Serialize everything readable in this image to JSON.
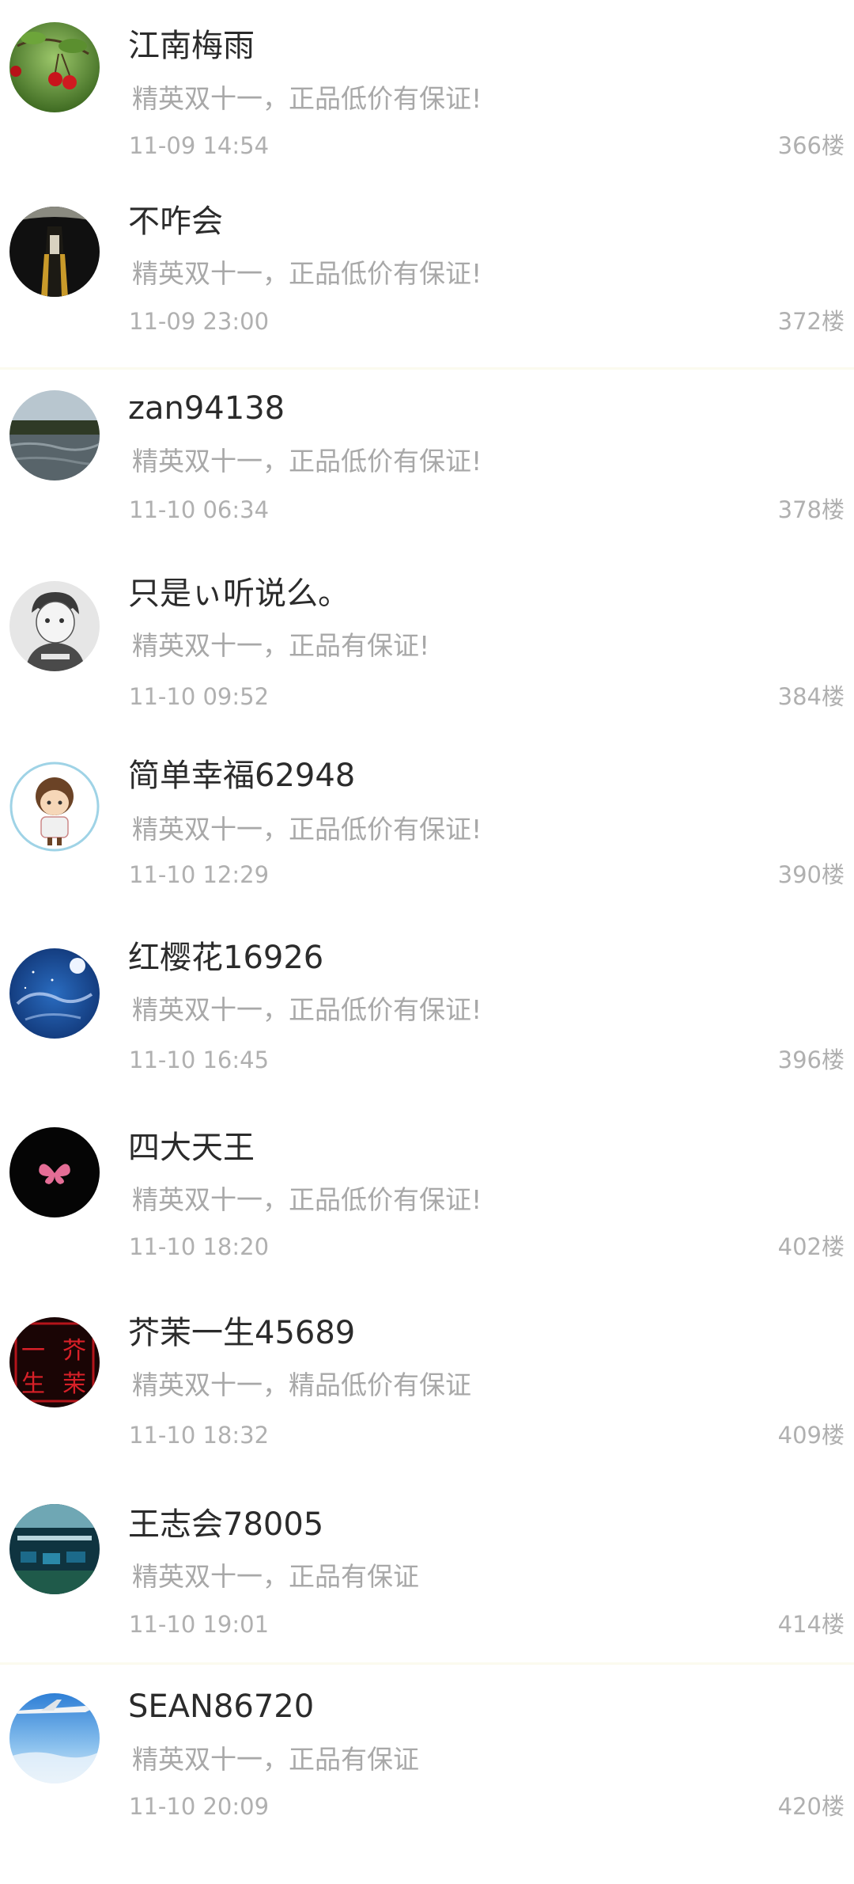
{
  "comments": [
    {
      "username": "江南梅雨",
      "message": "精英双十一，正品低价有保证!",
      "time": "11-09 14:54",
      "floor": "366楼",
      "avatar_icon": "cherry-photo-icon"
    },
    {
      "username": "不咋会",
      "message": "精英双十一，正品低价有保证!",
      "time": "11-09 23:00",
      "floor": "372楼",
      "avatar_icon": "bottle-photo-icon"
    },
    {
      "username": "zan94138",
      "message": "精英双十一，正品低价有保证!",
      "time": "11-10 06:34",
      "floor": "378楼",
      "avatar_icon": "lake-photo-icon"
    },
    {
      "username": "只是ぃ听说么。",
      "message": "精英双十一，正品有保证!",
      "time": "11-10 09:52",
      "floor": "384楼",
      "avatar_icon": "anime-boy-icon"
    },
    {
      "username": "简单幸福62948",
      "message": "精英双十一，正品低价有保证!",
      "time": "11-10 12:29",
      "floor": "390楼",
      "avatar_icon": "cartoon-girl-icon"
    },
    {
      "username": "红樱花16926",
      "message": "精英双十一，正品低价有保证!",
      "time": "11-10 16:45",
      "floor": "396楼",
      "avatar_icon": "night-sky-icon"
    },
    {
      "username": "四大天王",
      "message": "精英双十一，正品低价有保证!",
      "time": "11-10 18:20",
      "floor": "402楼",
      "avatar_icon": "butterfly-logo-icon"
    },
    {
      "username": "芥茉一生45689",
      "message": "精英双十一，精品低价有保证",
      "time": "11-10 18:32",
      "floor": "409楼",
      "avatar_icon": "red-seal-icon",
      "avatar_text": "芥茉一生"
    },
    {
      "username": "王志会78005",
      "message": "精英双十一，正品有保证",
      "time": "11-10 19:01",
      "floor": "414楼",
      "avatar_icon": "workshop-photo-icon"
    },
    {
      "username": "SEAN86720",
      "message": "精英双十一，正品有保证",
      "time": "11-10 20:09",
      "floor": "420楼",
      "avatar_icon": "airplane-photo-icon"
    }
  ]
}
